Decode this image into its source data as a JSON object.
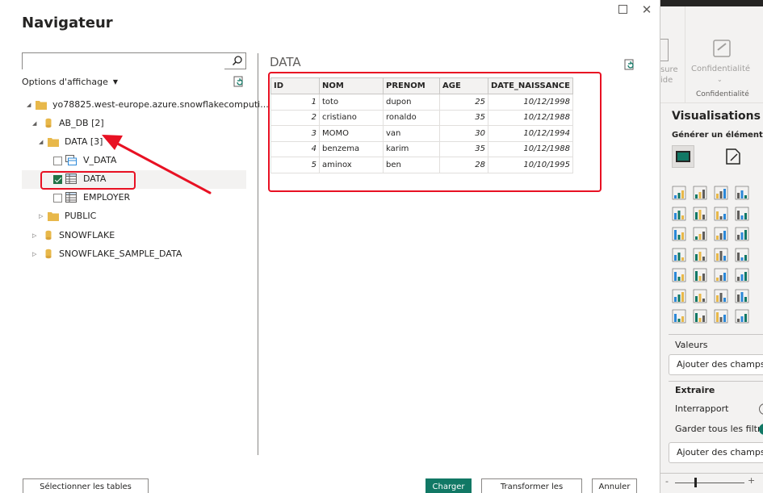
{
  "dialog": {
    "title": "Navigateur",
    "search": {
      "value": "",
      "placeholder": ""
    },
    "options_label": "Options d'affichage",
    "tree": {
      "root": "yo78825.west-europe.azure.snowflakecomputi...",
      "ab_db": "AB_DB [2]",
      "data_schema": "DATA [3]",
      "v_data": "V_DATA",
      "data_table": "DATA",
      "employer": "EMPLOYER",
      "public": "PUBLIC",
      "snowflake": "SNOWFLAKE",
      "snowflake_sample": "SNOWFLAKE_SAMPLE_DATA"
    },
    "preview": {
      "title": "DATA",
      "columns": [
        "ID",
        "NOM",
        "PRENOM",
        "AGE",
        "DATE_NAISSANCE"
      ],
      "rows": [
        [
          "1",
          "toto",
          "dupon",
          "25",
          "10/12/1998"
        ],
        [
          "2",
          "cristiano",
          "ronaldo",
          "35",
          "10/12/1988"
        ],
        [
          "3",
          "MOMO",
          "van",
          "30",
          "10/12/1994"
        ],
        [
          "4",
          "benzema",
          "karim",
          "35",
          "10/12/1988"
        ],
        [
          "5",
          "aminox",
          "ben",
          "28",
          "10/10/1995"
        ]
      ]
    },
    "buttons": {
      "select_related": "Sélectionner les tables associées",
      "load": "Charger",
      "transform": "Transformer les données",
      "cancel": "Annuler"
    }
  },
  "pbi": {
    "ribbon_partial_1": "sure",
    "ribbon_partial_2": "ide",
    "confidentiality": "Confidentialité",
    "confidentiality_group": "Confidentialité",
    "visualizations_title": "Visualisations",
    "build_visual": "Générer un élément vis",
    "values_label": "Valeurs",
    "values_well": "Ajouter des champs d",
    "drillthrough_label": "Extraire",
    "cross_report": "Interrapport",
    "keep_filters": "Garder tous les filtres",
    "drill_well": "Ajouter des champs d'"
  },
  "colors": {
    "accent_green": "#117865",
    "highlight_red": "#e81123",
    "folder_yellow": "#e8b84a"
  }
}
